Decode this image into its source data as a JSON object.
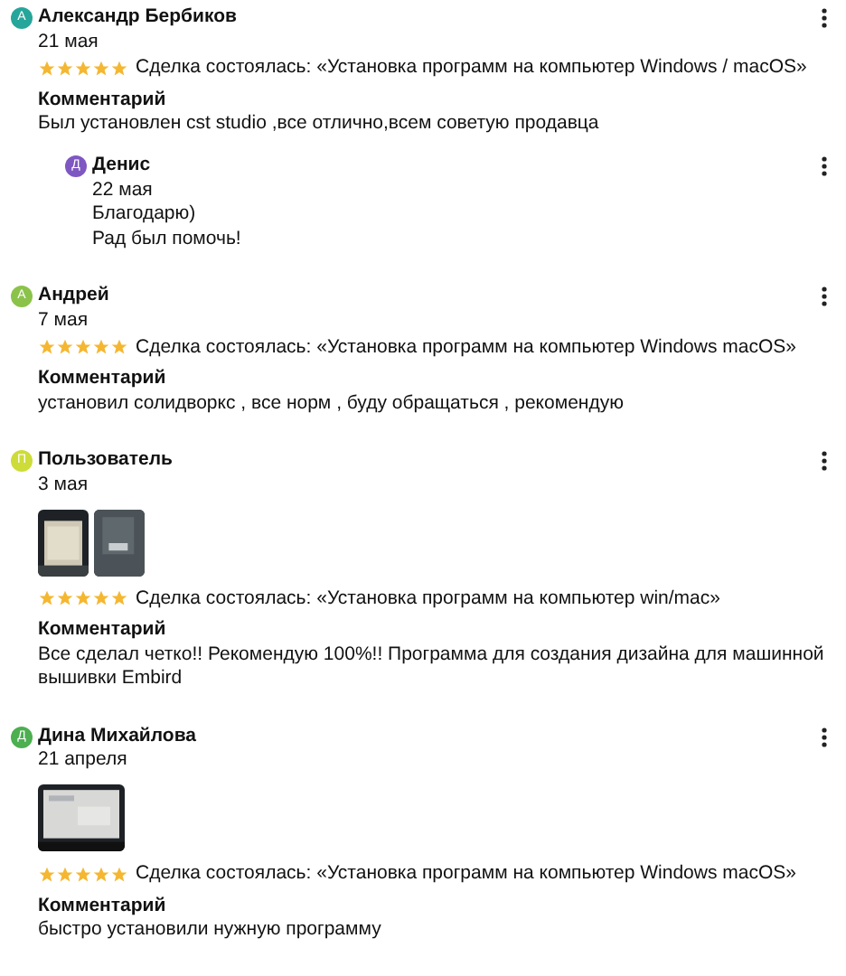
{
  "reviews": [
    {
      "author": {
        "initial": "А",
        "name": "Александр Бербиков",
        "color": "#26a69a"
      },
      "date": "21 мая",
      "stars": 5,
      "deal": "Сделка состоялась: «Установка программ на компьютер Windows / macOS»",
      "comment_label": "Комментарий",
      "comment": "Был установлен cst studio ,все отлично,всем советую продавца",
      "replies": [
        {
          "author": {
            "initial": "Д",
            "name": "Денис",
            "color": "#7e57c2"
          },
          "date": "22 мая",
          "lines": [
            "Благодарю)",
            "Рад был помочь!"
          ]
        }
      ]
    },
    {
      "author": {
        "initial": "А",
        "name": "Андрей",
        "color": "#8bc34a"
      },
      "date": "7 мая",
      "stars": 5,
      "deal": "Сделка состоялась: «Установка программ на компьютер Windows macOS»",
      "comment_label": "Комментарий",
      "comment": "установил солидворкс , все норм , буду обращаться , рекомендую"
    },
    {
      "author": {
        "initial": "П",
        "name": "Пользователь",
        "color": "#cddc39"
      },
      "date": "3 мая",
      "photos": [
        {
          "kind": "picture"
        },
        {
          "kind": "picture"
        }
      ],
      "stars": 5,
      "deal": "Сделка состоялась: «Установка программ на компьютер win/mac»",
      "comment_label": "Комментарий",
      "comment": "Все сделал четко!! Рекомендую 100%!! Программа для создания дизайна для машинной вышивки Embird"
    },
    {
      "author": {
        "initial": "Д",
        "name": "Дина Михайлова",
        "color": "#4caf50"
      },
      "date": "21 апреля",
      "photos": [
        {
          "kind": "picture"
        }
      ],
      "stars": 5,
      "deal": "Сделка состоялась: «Установка программ на компьютер Windows macOS»",
      "comment_label": "Комментарий",
      "comment": "быстро установили нужную программу"
    }
  ]
}
